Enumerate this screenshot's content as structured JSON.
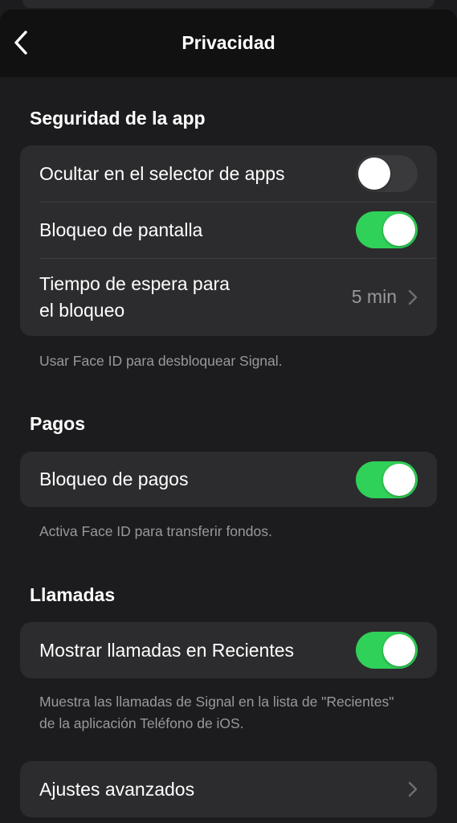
{
  "colors": {
    "background": "#1c1c1e",
    "navbar": "#111111",
    "cell": "#2c2c2e",
    "toggle_on": "#30d158",
    "toggle_off": "#3a3a3c",
    "secondary_text": "#98989e"
  },
  "navbar": {
    "back_icon": "chevron-left-icon",
    "title": "Privacidad"
  },
  "sections": {
    "app_security": {
      "title": "Seguridad de la app",
      "rows": {
        "hide_in_switcher": {
          "label": "Ocultar en el selector de apps",
          "toggle_on": false
        },
        "screen_lock": {
          "label": "Bloqueo de pantalla",
          "toggle_on": true
        },
        "lock_timeout": {
          "label_line1": "Tiempo de espera para",
          "label_line2": "el bloqueo",
          "value": "5 min"
        }
      },
      "footer": "Usar Face ID para desbloquear Signal."
    },
    "payments": {
      "title": "Pagos",
      "rows": {
        "payment_lock": {
          "label": "Bloqueo de pagos",
          "toggle_on": true
        }
      },
      "footer": "Activa Face ID para transferir fondos."
    },
    "calls": {
      "title": "Llamadas",
      "rows": {
        "show_in_recents": {
          "label": "Mostrar llamadas en Recientes",
          "toggle_on": true
        }
      },
      "footer": "Muestra las llamadas de Signal en la lista de \"Recientes\" de la aplicación Teléfono de iOS."
    },
    "advanced": {
      "rows": {
        "advanced_settings": {
          "label": "Ajustes avanzados"
        }
      }
    }
  }
}
